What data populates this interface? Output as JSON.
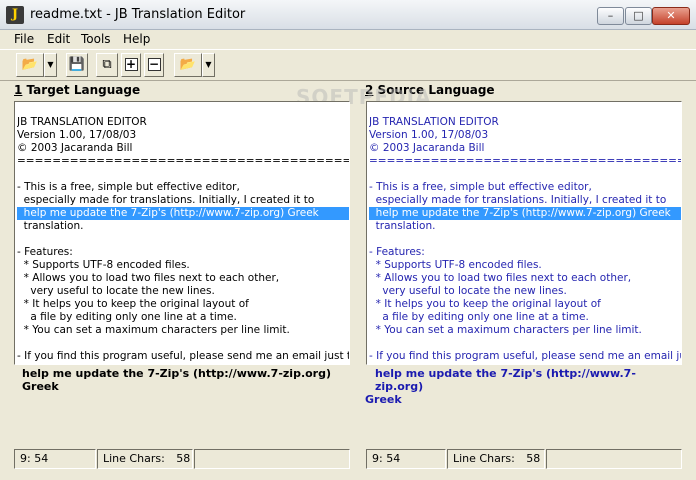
{
  "window": {
    "title": "readme.txt - JB Translation Editor",
    "icon_letter": "J",
    "controls": {
      "minimize": "–",
      "maximize": "□",
      "close": "✕"
    }
  },
  "menu": [
    "File",
    "Edit",
    "Tools",
    "Help"
  ],
  "toolbar": {
    "icons": [
      "open-folder-icon",
      "save-disk-icon",
      "compare-icon",
      "expand-icon",
      "collapse-icon",
      "open-folder-icon"
    ],
    "glyphs": {
      "folder": "📂",
      "disk": "💾",
      "compare": "⧉",
      "plus": "+",
      "minus": "−",
      "dropdown": "▼"
    }
  },
  "watermark": "SOFTPEDIA",
  "left_panel": {
    "number": "1",
    "title": "Target Language",
    "lines": [
      "JB TRANSLATION EDITOR",
      "Version 1.00, 17/08/03",
      "© 2003 Jacaranda Bill",
      "=======================================================",
      "",
      "- This is a free, simple but effective editor,",
      "  especially made for translations. Initially, I created it to",
      "  help me update the 7-Zip's (http://www.7-zip.org) Greek",
      "  translation.",
      "",
      "- Features:",
      "  * Supports UTF-8 encoded files.",
      "  * Allows you to load two files next to each other,",
      "    very useful to locate the new lines.",
      "  * It helps you to keep the original layout of",
      "    a file by editing only one line at a time.",
      "  * You can set a maximum characters per line limit.",
      "",
      "- If you find this program useful, please send me an email just to inform"
    ],
    "selected_index": 7,
    "current_line": "help me update the 7-Zip's (http://www.7-zip.org) Greek",
    "status": {
      "position": "9:  54",
      "line_chars_label": "Line Chars:",
      "line_chars_value": "58"
    }
  },
  "right_panel": {
    "number": "2",
    "title": "Source Language",
    "lines": [
      "JB TRANSLATION EDITOR",
      "Version 1.00, 17/08/03",
      "© 2003 Jacaranda Bill",
      "=======================================================",
      "",
      "- This is a free, simple but effective editor,",
      "  especially made for translations. Initially, I created it to",
      "  help me update the 7-Zip's (http://www.7-zip.org) Greek",
      "  translation.",
      "",
      "- Features:",
      "  * Supports UTF-8 encoded files.",
      "  * Allows you to load two files next to each other,",
      "    very useful to locate the new lines.",
      "  * It helps you to keep the original layout of",
      "    a file by editing only one line at a time.",
      "  * You can set a maximum characters per line limit.",
      "",
      "- If you find this program useful, please send me an email just to inf"
    ],
    "selected_index": 7,
    "current_line_1": "help me update the 7-Zip's (http://www.7-zip.org)",
    "current_line_2": "Greek",
    "status": {
      "position": "9:  54",
      "line_chars_label": "Line Chars:",
      "line_chars_value": "58"
    }
  }
}
